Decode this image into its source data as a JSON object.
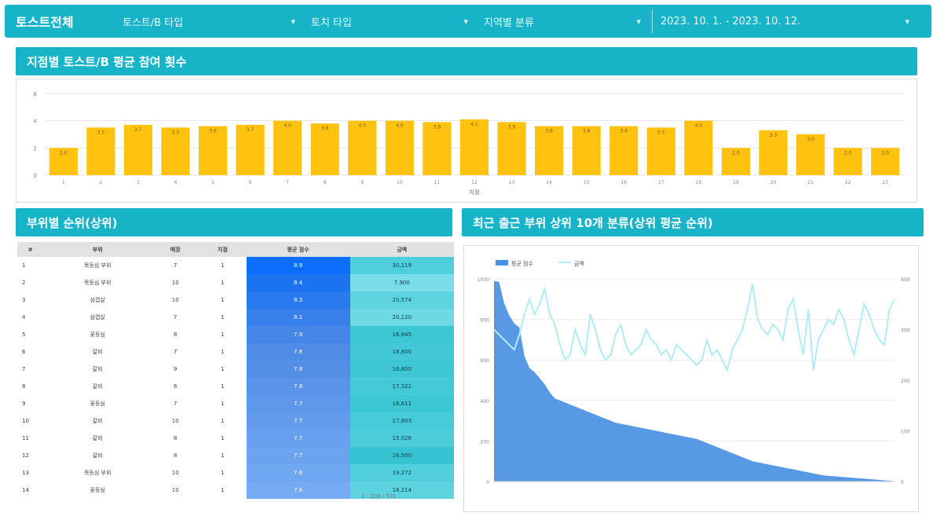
{
  "header": {
    "title": "토스트전체",
    "filters": [
      {
        "label": "토스트/B 타입",
        "icon": "chevron-down-icon"
      },
      {
        "label": "토치 타입",
        "icon": "chevron-down-icon"
      },
      {
        "label": "지역별 분류",
        "icon": "chevron-down-icon"
      }
    ],
    "date_range": "2023. 10. 1. - 2023. 10. 12."
  },
  "colors": {
    "header": "#17b3c6",
    "bar": "#ffc20e",
    "area": "#4a90e2",
    "line": "#b2ebf2"
  },
  "top_chart": {
    "title": "지점별 토스트/B 평균 참여 횟수",
    "chart_data": {
      "type": "bar",
      "title": "지점별 토스트/B 평균 참여 횟수",
      "categories": [
        "1",
        "2",
        "3",
        "4",
        "5",
        "6",
        "7",
        "8",
        "9",
        "10",
        "11",
        "12",
        "13",
        "14",
        "15",
        "16",
        "17",
        "18",
        "19",
        "20",
        "21",
        "22",
        "23"
      ],
      "values": [
        2.0,
        3.5,
        3.7,
        3.5,
        3.6,
        3.7,
        4.0,
        3.8,
        4.0,
        4.0,
        3.9,
        4.1,
        3.9,
        3.6,
        3.6,
        3.6,
        3.5,
        4.0,
        2.0,
        3.3,
        3.0,
        2.0,
        2.0
      ],
      "yticks": [
        0,
        2,
        4,
        6
      ],
      "ylim": [
        0,
        6
      ],
      "xlabel": "지점",
      "ylabel": "",
      "grid": true
    }
  },
  "left_panel": {
    "title": "부위별 순위(상위)",
    "columns": [
      "#",
      "부위",
      "매장",
      "지점",
      "평균 점수",
      "금액"
    ],
    "rows": [
      [
        "1",
        "목등심 부위",
        "7",
        "1",
        "8.9",
        "30,119"
      ],
      [
        "2",
        "목등심 부위",
        "10",
        "1",
        "8.4",
        "7,900"
      ],
      [
        "3",
        "삼겹살",
        "10",
        "1",
        "8.3",
        "20,574"
      ],
      [
        "4",
        "삼겹살",
        "7",
        "1",
        "8.1",
        "20,120"
      ],
      [
        "5",
        "꽃등심",
        "8",
        "1",
        "7.9",
        "16,845"
      ],
      [
        "6",
        "갈비",
        "7",
        "1",
        "7.8",
        "18,800"
      ],
      [
        "7",
        "갈비",
        "9",
        "1",
        "7.8",
        "16,800"
      ],
      [
        "8",
        "갈비",
        "6",
        "1",
        "7.8",
        "17,321"
      ],
      [
        "9",
        "꽃등심",
        "7",
        "1",
        "7.7",
        "18,611"
      ],
      [
        "10",
        "갈비",
        "10",
        "1",
        "7.7",
        "17,803"
      ],
      [
        "11",
        "갈비",
        "8",
        "1",
        "7.7",
        "15,026"
      ],
      [
        "12",
        "갈비",
        "8",
        "1",
        "7.7",
        "16,500"
      ],
      [
        "13",
        "목등심 부위",
        "10",
        "1",
        "7.6",
        "19,272"
      ],
      [
        "14",
        "꽃등심",
        "10",
        "1",
        "7.6",
        "18,214"
      ]
    ],
    "pager": "1 - 100 / 531"
  },
  "right_panel": {
    "title": "최근 출근 부위 상위 10개 분류(상위 평균 순위)",
    "chart_data": {
      "type": "area",
      "legend": [
        "평균 점수",
        "금액"
      ],
      "legend_position": "top-left",
      "y_left_ticks": [
        0,
        200,
        400,
        600,
        800,
        1000
      ],
      "y_right_ticks": [
        0,
        100,
        200,
        300,
        400
      ],
      "series": [
        {
          "name": "평균 점수",
          "values": [
            990,
            985,
            880,
            820,
            780,
            760,
            620,
            560,
            540,
            510,
            480,
            440,
            410,
            400,
            390,
            380,
            370,
            360,
            350,
            340,
            330,
            320,
            310,
            300,
            290,
            285,
            280,
            275,
            270,
            265,
            260,
            255,
            250,
            245,
            240,
            235,
            230,
            225,
            220,
            215,
            210,
            200,
            190,
            180,
            170,
            160,
            150,
            140,
            130,
            120,
            110,
            100,
            95,
            90,
            85,
            80,
            75,
            70,
            65,
            60,
            55,
            50,
            45,
            40,
            35,
            30,
            28,
            26,
            24,
            22,
            20,
            18,
            16,
            14,
            12,
            10,
            8,
            6,
            4,
            2
          ]
        },
        {
          "name": "금액",
          "values": [
            300,
            290,
            280,
            270,
            260,
            290,
            330,
            360,
            330,
            350,
            380,
            330,
            310,
            270,
            240,
            250,
            300,
            270,
            250,
            330,
            300,
            260,
            240,
            250,
            290,
            310,
            270,
            250,
            260,
            270,
            300,
            280,
            270,
            250,
            260,
            240,
            270,
            260,
            250,
            240,
            230,
            240,
            280,
            250,
            260,
            240,
            220,
            260,
            280,
            300,
            340,
            390,
            320,
            300,
            290,
            310,
            300,
            280,
            340,
            360,
            300,
            250,
            340,
            220,
            280,
            300,
            320,
            310,
            340,
            320,
            280,
            250,
            300,
            350,
            330,
            300,
            280,
            270,
            340,
            360
          ]
        }
      ]
    }
  }
}
